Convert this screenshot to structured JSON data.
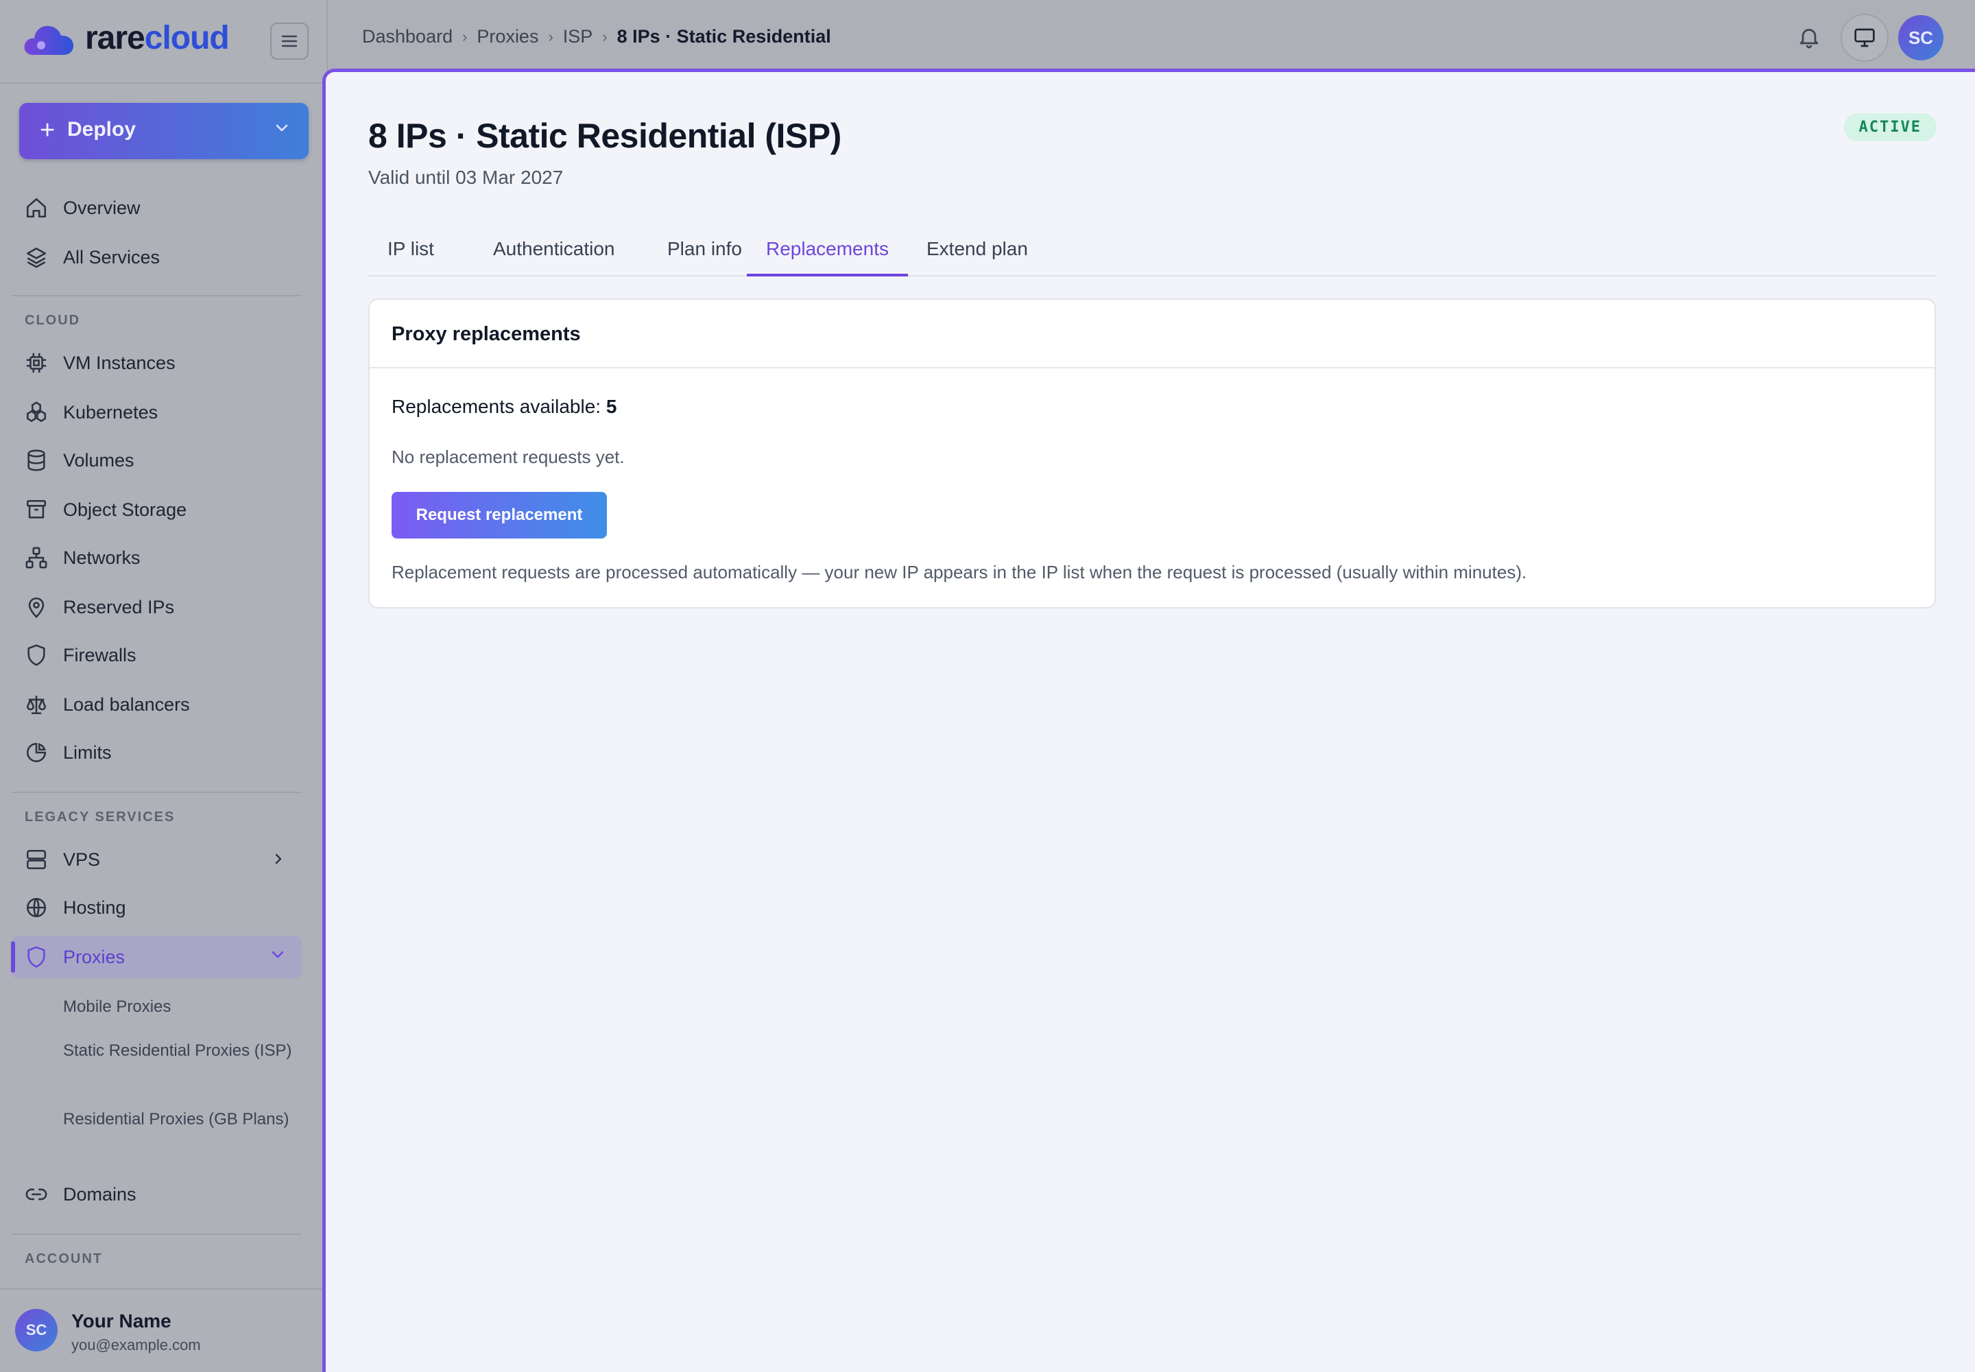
{
  "app": {
    "logo_part1": "rare",
    "logo_part2": "cloud"
  },
  "sidebar": {
    "deploy_label": "Deploy",
    "top_items": [
      {
        "label": "Overview",
        "icon": "home-icon"
      },
      {
        "label": "All Services",
        "icon": "layers-icon"
      }
    ],
    "cloud_section": "CLOUD",
    "cloud_items": [
      {
        "label": "VM Instances",
        "icon": "chip-icon"
      },
      {
        "label": "Kubernetes",
        "icon": "kubernetes-icon"
      },
      {
        "label": "Volumes",
        "icon": "database-icon"
      },
      {
        "label": "Object Storage",
        "icon": "archive-icon"
      },
      {
        "label": "Networks",
        "icon": "network-icon"
      },
      {
        "label": "Reserved IPs",
        "icon": "pin-icon"
      },
      {
        "label": "Firewalls",
        "icon": "shield-icon"
      },
      {
        "label": "Load balancers",
        "icon": "scale-icon"
      },
      {
        "label": "Limits",
        "icon": "pie-chart-icon"
      }
    ],
    "legacy_section": "LEGACY SERVICES",
    "legacy_items": [
      {
        "label": "VPS",
        "icon": "server-icon"
      },
      {
        "label": "Hosting",
        "icon": "globe-icon"
      },
      {
        "label": "Proxies",
        "icon": "shield-icon"
      }
    ],
    "proxy_sub_items": [
      "Mobile Proxies",
      "Static Residential Proxies (ISP)",
      "Residential Proxies (GB Plans)"
    ],
    "domains_label": "Domains",
    "account_section": "ACCOUNT",
    "user": {
      "initials": "SC",
      "name": "Your Name",
      "email": "you@example.com"
    }
  },
  "topbar": {
    "breadcrumb": [
      "Dashboard",
      "Proxies",
      "ISP",
      "8 IPs · Static Residential"
    ],
    "avatar_initials": "SC"
  },
  "page": {
    "title": "8 IPs · Static Residential (ISP)",
    "subtitle": "Valid until 03 Mar 2027",
    "status": "ACTIVE",
    "tabs": [
      "IP list",
      "Authentication",
      "Plan info",
      "Replacements",
      "Extend plan"
    ],
    "active_tab": "Replacements"
  },
  "card": {
    "title": "Proxy replacements",
    "available_label": "Replacements available:",
    "available_count": "5",
    "empty_text": "No replacement requests yet.",
    "button_label": "Request replacement",
    "note": "Replacement requests are processed automatically — your new IP appears in the IP list when the request is processed (usually within minutes)."
  },
  "colors": {
    "accent": "#6d46dd",
    "status_green": "#17855a",
    "status_bg": "#d5f3e6"
  }
}
